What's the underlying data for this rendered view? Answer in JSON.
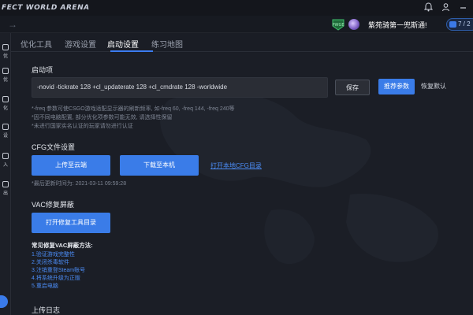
{
  "app": {
    "brand": "FECT WORLD ARENA"
  },
  "user": {
    "badge_text": "PWGE",
    "name": "紫苑骑第一兜斯通!",
    "message_count": "7 / 2"
  },
  "tabs": [
    {
      "label": "优化工具"
    },
    {
      "label": "游戏设置"
    },
    {
      "label": "启动设置"
    },
    {
      "label": "练习地图"
    }
  ],
  "active_tab_index": 2,
  "launch": {
    "title": "启动项",
    "value": "-novid -tickrate 128 +cl_updaterate 128 +cl_cmdrate 128 -worldwide",
    "save_label": "保存",
    "recommend_label": "推荐参数",
    "reset_label": "恢复默认",
    "hints": [
      "*-freq 参数可使CSGO游戏适配显示器的刷新频率, 如-freq 60, -freq 144, -freq 240等",
      "*因不同电脑配置, 部分优化项参数可能无效, 请选择性保留",
      "*未进行国家实名认证的玩家请勿进行认证"
    ]
  },
  "cfg": {
    "title": "CFG文件设置",
    "upload_label": "上传至云端",
    "download_label": "下载至本机",
    "open_dir_label": "打开本地CFG目录",
    "last_update": "*最后更新时间为: 2021-03-11 09:59:28"
  },
  "vac": {
    "title": "VAC修复屏蔽",
    "open_tool_label": "打开修复工具目录",
    "methods_title": "常见修复VAC屏蔽方法:",
    "steps": [
      "1.验证游戏完整性",
      "2.关闭杀毒软件",
      "3.注销重登Steam账号",
      "4.将系统升级为正版",
      "5.重启电脑"
    ]
  },
  "upload_log": {
    "title": "上传日志"
  },
  "rail": {
    "items": [
      "优",
      "优",
      "化",
      "设",
      "入",
      "出"
    ]
  },
  "colors": {
    "accent": "#3a7ce8",
    "link": "#4b8cf5",
    "background": "#1b1e26"
  }
}
